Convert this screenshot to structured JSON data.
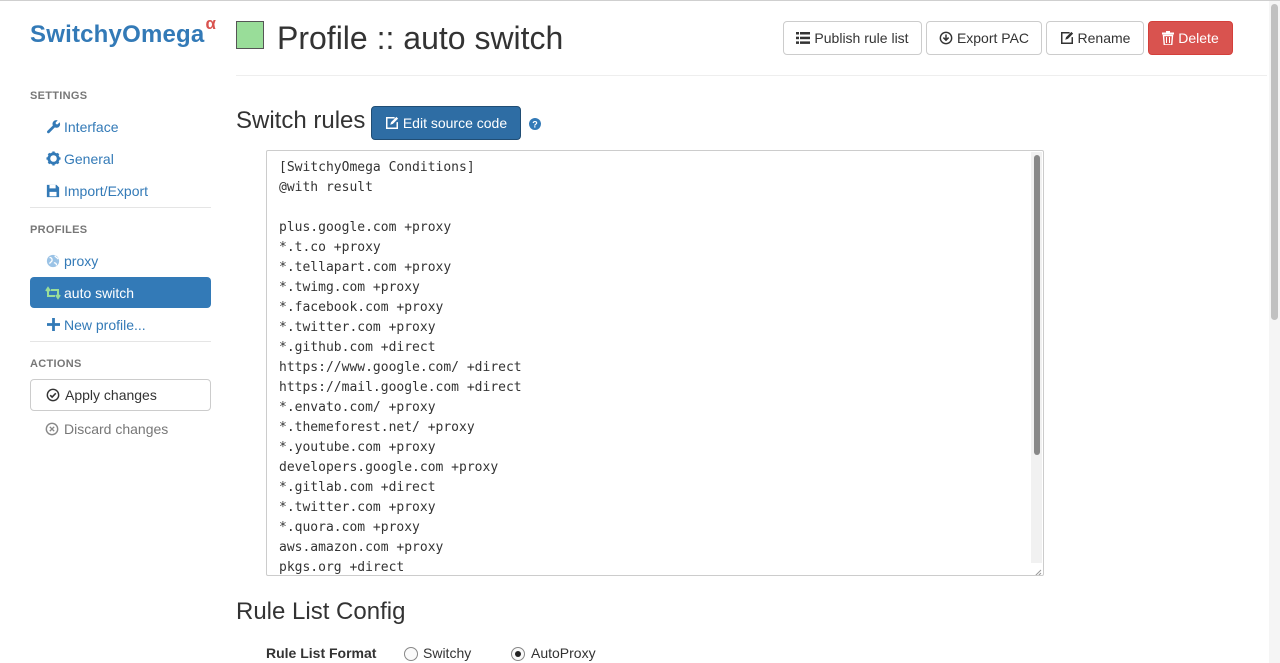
{
  "sidebar": {
    "brand": "SwitchyOmega",
    "brand_suffix": "α",
    "settings_header": "SETTINGS",
    "settings_items": [
      "Interface",
      "General",
      "Import/Export"
    ],
    "profiles_header": "PROFILES",
    "profile_items": [
      "proxy",
      "auto switch"
    ],
    "new_profile": "New profile...",
    "actions_header": "ACTIONS",
    "apply_changes": "Apply changes",
    "discard_changes": "Discard changes"
  },
  "header": {
    "profile_color": "#99dd99",
    "title": "Profile :: auto switch",
    "buttons": {
      "publish": "Publish rule list",
      "export": "Export PAC",
      "rename": "Rename",
      "delete": "Delete"
    }
  },
  "switch_rules": {
    "title": "Switch rules",
    "edit_source_button": "Edit source code",
    "source_lines": [
      "[SwitchyOmega Conditions]",
      "@with result",
      "",
      "plus.google.com +proxy",
      "*.t.co +proxy",
      "*.tellapart.com +proxy",
      "*.twimg.com +proxy",
      "*.facebook.com +proxy",
      "*.twitter.com +proxy",
      "*.github.com +direct",
      "https://www.google.com/ +direct",
      "https://mail.google.com +direct",
      "*.envato.com/ +proxy",
      "*.themeforest.net/ +proxy",
      "*.youtube.com +proxy",
      "developers.google.com +proxy",
      "*.gitlab.com +direct",
      "*.twitter.com +proxy",
      "*.quora.com +proxy",
      "aws.amazon.com +proxy",
      "pkgs.org +direct"
    ]
  },
  "rule_list_config": {
    "title": "Rule List Config",
    "format_label": "Rule List Format",
    "options": [
      "Switchy",
      "AutoProxy"
    ],
    "selected": "AutoProxy"
  },
  "colors": {
    "link": "#337ab7",
    "active_bg": "#337ab7",
    "danger": "#d9534f",
    "primary_dark": "#2e6da4"
  }
}
